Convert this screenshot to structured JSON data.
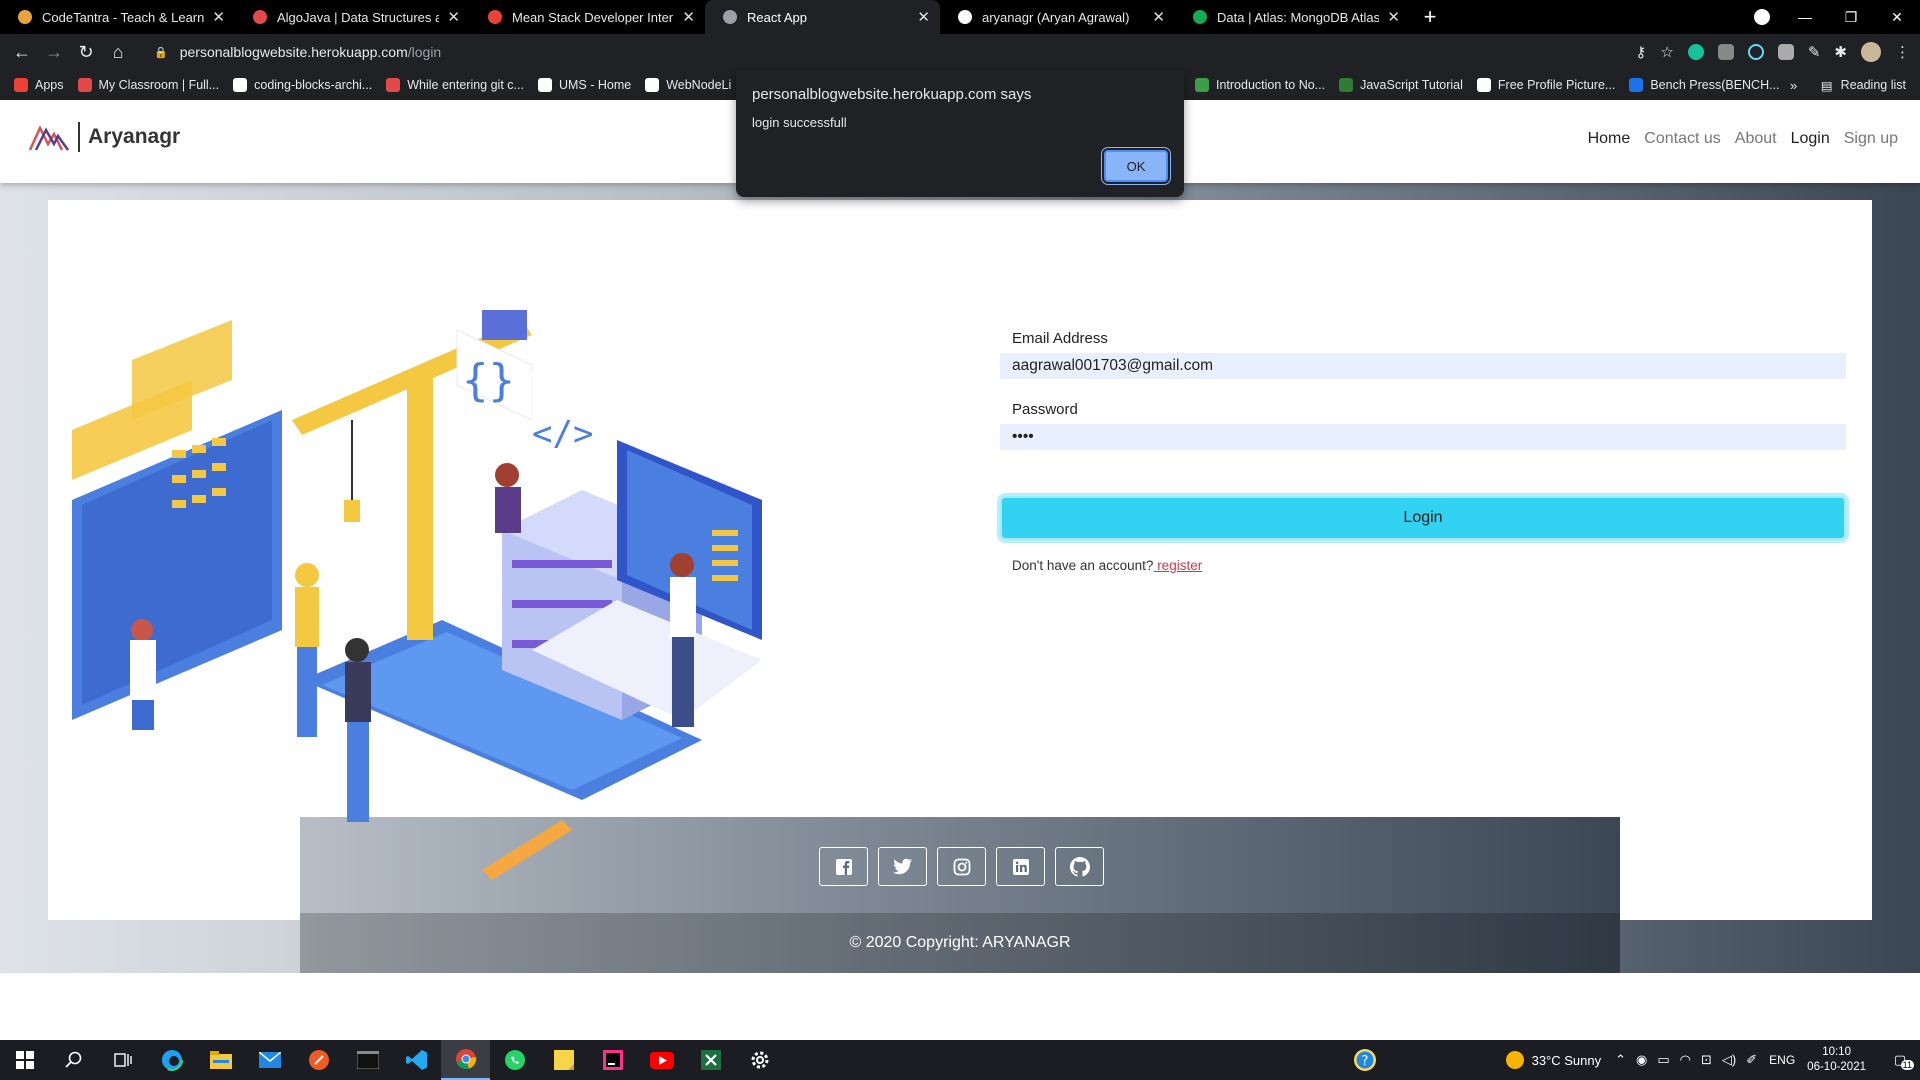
{
  "browser": {
    "tabs": [
      {
        "label": "CodeTantra - Teach & Learn Any",
        "favicon": "codetantra-icon",
        "color": "#e8a33d",
        "active": false
      },
      {
        "label": "AlgoJava | Data Structures and A",
        "favicon": "algojava-icon",
        "color": "#e24a4a",
        "active": false
      },
      {
        "label": "Mean Stack Developer Internship",
        "favicon": "gmail-icon",
        "color": "#ea4335",
        "active": false
      },
      {
        "label": "React App",
        "favicon": "globe-icon",
        "color": "#9aa0a6",
        "active": true
      },
      {
        "label": "aryanagr (Aryan Agrawal)",
        "favicon": "github-icon",
        "color": "#ffffff",
        "active": false
      },
      {
        "label": "Data | Atlas: MongoDB Atlas",
        "favicon": "mongodb-icon",
        "color": "#13aa52",
        "active": false
      }
    ],
    "url_host": "personalblogwebsite.herokuapp.com",
    "url_path": "/login",
    "bookmarks": [
      {
        "label": "Apps",
        "color": "#ea4335"
      },
      {
        "label": "My Classroom | Full...",
        "color": "#e24a4a"
      },
      {
        "label": "coding-blocks-archi...",
        "color": "#ffffff"
      },
      {
        "label": "While entering git c...",
        "color": "#e24a4a"
      },
      {
        "label": "UMS - Home",
        "color": "#ffffff"
      },
      {
        "label": "WebNodeLi",
        "color": "#ffffff"
      }
    ],
    "bookmarks_right": [
      {
        "label": "Introduction to No...",
        "color": "#3c9e4a"
      },
      {
        "label": "JavaScript Tutorial",
        "color": "#2e7d32"
      },
      {
        "label": "Free Profile Picture...",
        "color": "#ffffff"
      },
      {
        "label": "Bench Press(BENCH...",
        "color": "#1a73e8"
      }
    ],
    "reading_list": "Reading list",
    "overflow": "»"
  },
  "dialog": {
    "title": "personalblogwebsite.herokuapp.com says",
    "message": "login successfull",
    "ok": "OK"
  },
  "site": {
    "brand": "Aryanagr",
    "nav": [
      "Home",
      "Contact us",
      "About",
      "Login",
      "Sign up"
    ],
    "form": {
      "email_label": "Email Address",
      "email_value": "aagrawal001703@gmail.com",
      "password_label": "Password",
      "password_value": "••••",
      "login_button": "Login",
      "no_account": "Don't have an account?",
      "register_link": " register"
    },
    "footer": {
      "social_icons": [
        "facebook-icon",
        "twitter-icon",
        "instagram-icon",
        "linkedin-icon",
        "github-icon"
      ],
      "copyright": "© 2020 Copyright: ARYANAGR"
    }
  },
  "taskbar": {
    "weather": "33°C  Sunny",
    "language": "ENG",
    "time": "10:10",
    "date": "06-10-2021",
    "notifications": "11"
  }
}
